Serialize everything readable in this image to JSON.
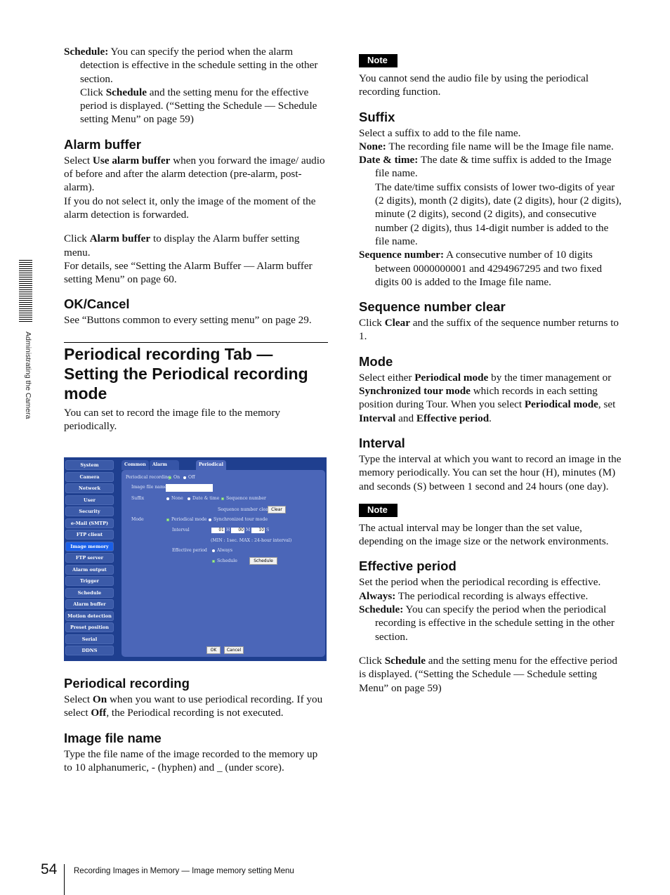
{
  "side_tab": {
    "text": "Administrating the Camera"
  },
  "footer": {
    "page_number": "54",
    "running_title": "Recording Images in Memory — Image memory setting Menu"
  },
  "left": {
    "schedule_item": {
      "term": "Schedule:",
      "text": "You can specify the period when the alarm detection is effective in the schedule setting in the other section.",
      "click_pre": "Click ",
      "click_bold": "Schedule",
      "click_post": " and the setting menu for the effective period is displayed. (“Setting the Schedule — Schedule setting Menu” on page 59)"
    },
    "alarm_buffer": {
      "heading": "Alarm buffer",
      "p1_pre": "Select ",
      "p1_bold": "Use alarm buffer",
      "p1_post": " when you forward the image/ audio of before and after the alarm detection (pre-alarm, post-alarm).",
      "p2": "If you do not select it, only the image of the moment of the alarm detection is forwarded.",
      "p3_pre": "Click ",
      "p3_bold": "Alarm buffer",
      "p3_post": " to display the Alarm buffer setting menu.",
      "p4": "For details, see “Setting the Alarm Buffer — Alarm buffer setting Menu” on page 60."
    },
    "ok_cancel": {
      "heading": "OK/Cancel",
      "text": "See “Buttons common to every setting menu” on page 29."
    },
    "section": {
      "title": "Periodical recording Tab — Setting the Periodical recording mode",
      "intro": "You can set to record the image file to the memory periodically."
    },
    "periodical_recording": {
      "heading": "Periodical recording",
      "pre": "Select ",
      "on": "On",
      "mid": " when you want to use periodical recording. If you select ",
      "off": "Off",
      "post": ", the Periodical recording is not executed."
    },
    "image_file_name": {
      "heading": "Image file name",
      "text": "Type the file name of the image recorded to the memory up to 10 alphanumeric, - (hyphen) and _ (under score)."
    }
  },
  "screenshot": {
    "nav_items": [
      "System",
      "Camera",
      "Network",
      "User",
      "Security",
      "e-Mail (SMTP)",
      "FTP client",
      "Image memory",
      "FTP server",
      "Alarm output",
      "Trigger",
      "Schedule",
      "Alarm buffer",
      "Motion detection",
      "Preset position",
      "Serial",
      "DDNS"
    ],
    "active_nav": "Image memory",
    "tabs": [
      "Common",
      "Alarm recording",
      "Periodical recording"
    ],
    "active_tab": "Periodical recording",
    "periodical_recording_label": "Periodical recording",
    "on_label": "On",
    "off_label": "Off",
    "periodical_recording_value": "On",
    "image_file_name_label": "Image file name",
    "image_file_name_value": "",
    "suffix_label": "Suffix",
    "suffix_options": [
      "None",
      "Date & time",
      "Sequence number"
    ],
    "suffix_value": "Sequence number",
    "seq_clear_label": "Sequence number clear",
    "clear_button": "Clear",
    "mode_label": "Mode",
    "mode_options": [
      "Periodical mode",
      "Synchronized tour mode"
    ],
    "mode_value": "Periodical mode",
    "interval_label": "Interval",
    "interval_h": "01",
    "interval_m": "00",
    "interval_s": "10",
    "h_unit": "H",
    "m_unit": "M",
    "s_unit": "S",
    "interval_hint": "(MIN : 1sec. MAX : 24-hour interval)",
    "effective_period_label": "Effective period",
    "effective_options": [
      "Always",
      "Schedule"
    ],
    "effective_value": "Schedule",
    "schedule_button": "Schedule",
    "ok_button": "OK",
    "cancel_button": "Cancel"
  },
  "right": {
    "note1": {
      "label": "Note",
      "text": "You cannot send the audio file by using the periodical recording function."
    },
    "suffix": {
      "heading": "Suffix",
      "intro": "Select a suffix to add to the file name.",
      "none_term": "None:",
      "none_text": " The recording file name will be the Image file name.",
      "dt_term": "Date & time:",
      "dt_text": " The date & time suffix is added to the Image file name.",
      "dt_detail": "The date/time suffix consists of lower two-digits of year (2 digits), month (2 digits), date (2 digits), hour (2 digits), minute (2 digits), second (2 digits), and consecutive number (2 digits), thus 14-digit number is added to the file name.",
      "seq_term": "Sequence number:",
      "seq_text": " A consecutive number of 10 digits between 0000000001 and 4294967295 and two fixed digits 00 is added to the Image file name."
    },
    "seq_clear": {
      "heading": "Sequence number clear",
      "pre": "Click ",
      "bold": "Clear",
      "post": " and the suffix of the sequence number returns to 1."
    },
    "mode": {
      "heading": "Mode",
      "t1": "Select either ",
      "b1": "Periodical mode",
      "t2": " by the timer management or ",
      "b2": "Synchronized tour mode",
      "t3": " which records in each setting position during Tour.  When you select ",
      "b3": "Periodical mode",
      "t4": ", set ",
      "b4": "Interval",
      "t5": " and ",
      "b5": "Effective period",
      "t6": "."
    },
    "interval": {
      "heading": "Interval",
      "text": "Type the interval at which you want to record an image in the memory periodically. You can set the hour (H), minutes (M) and seconds (S) between 1 second and 24 hours (one day)."
    },
    "note2": {
      "label": "Note",
      "text": "The actual interval may be longer than the set value, depending on the image size or the network environments."
    },
    "effective_period": {
      "heading": "Effective period",
      "intro": "Set the period when the periodical recording is effective.",
      "always_term": "Always:",
      "always_text": " The periodical recording is always effective.",
      "sched_term": "Schedule:",
      "sched_text": " You can specify the period when the periodical recording is effective in the schedule setting in the other section.",
      "click_pre": "Click ",
      "click_bold": "Schedule",
      "click_post": " and the setting menu for the effective period is displayed. (“Setting the Schedule — Schedule setting Menu” on page 59)"
    }
  }
}
